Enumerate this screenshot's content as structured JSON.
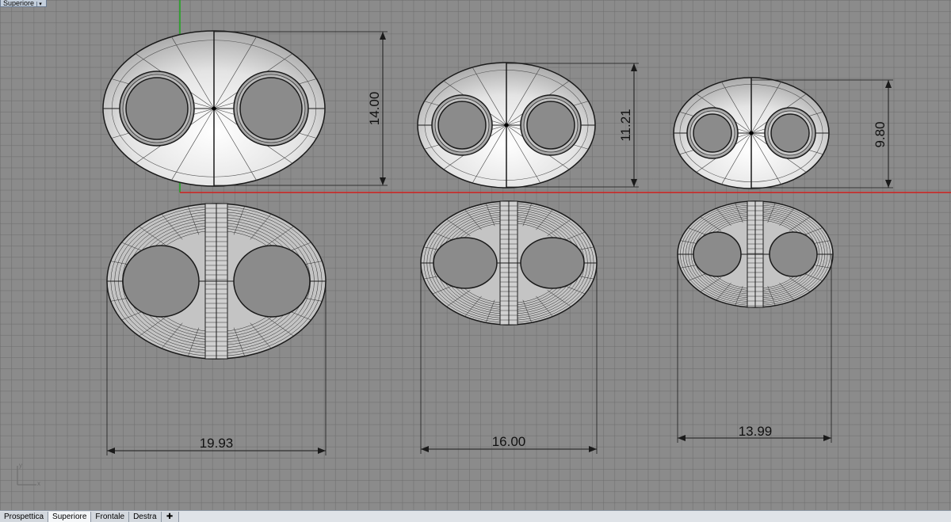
{
  "viewport": {
    "title": "Superiore",
    "menu_icon": "chevron-down-icon"
  },
  "dimensions": {
    "height_large": "14.00",
    "height_medium": "11.21",
    "height_small": "9.80",
    "width_large": "19.93",
    "width_medium": "16.00",
    "width_small": "13.99"
  },
  "tabs": [
    {
      "label": "Prospettica",
      "active": false
    },
    {
      "label": "Superiore",
      "active": true
    },
    {
      "label": "Frontale",
      "active": false
    },
    {
      "label": "Destra",
      "active": false
    }
  ],
  "add_tab_icon": "plus-icon",
  "colors": {
    "x_axis": "#d0201c",
    "y_axis": "#1fa81f",
    "grid": "#7a7a7a",
    "background": "#8b8b8b"
  }
}
